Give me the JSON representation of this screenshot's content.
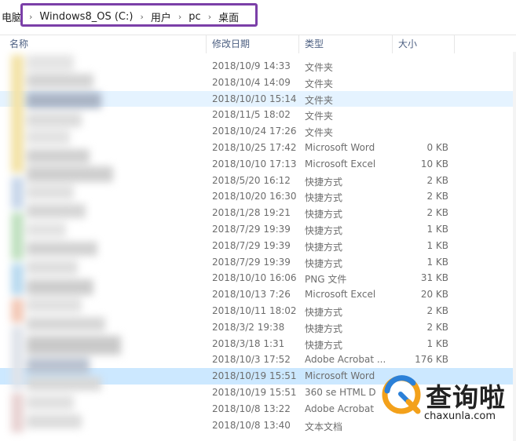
{
  "address": {
    "crumbs": [
      {
        "label": "电脑"
      },
      {
        "label": "Windows8_OS (C:)"
      },
      {
        "label": "用户"
      },
      {
        "label": "pc"
      },
      {
        "label": "桌面"
      }
    ]
  },
  "columns": {
    "name": "名称",
    "date": "修改日期",
    "type": "类型",
    "size": "大小"
  },
  "rows": [
    {
      "date": "2018/10/9 14:33",
      "type": "文件夹",
      "size": ""
    },
    {
      "date": "2018/10/4 14:09",
      "type": "文件夹",
      "size": ""
    },
    {
      "date": "2018/10/10 15:14",
      "type": "文件夹",
      "size": ""
    },
    {
      "date": "2018/11/5 18:02",
      "type": "文件夹",
      "size": ""
    },
    {
      "date": "2018/10/24 17:26",
      "type": "文件夹",
      "size": ""
    },
    {
      "date": "2018/10/25 17:42",
      "type": "Microsoft Word",
      "size": "0 KB"
    },
    {
      "date": "2018/10/10 17:13",
      "type": "Microsoft Excel",
      "size": "10 KB"
    },
    {
      "date": "2018/5/20 16:12",
      "type": "快捷方式",
      "size": "2 KB"
    },
    {
      "date": "2018/10/20 16:30",
      "type": "快捷方式",
      "size": "2 KB"
    },
    {
      "date": "2018/1/28 19:21",
      "type": "快捷方式",
      "size": "2 KB"
    },
    {
      "date": "2018/7/29 19:39",
      "type": "快捷方式",
      "size": "1 KB"
    },
    {
      "date": "2018/7/29 19:39",
      "type": "快捷方式",
      "size": "1 KB"
    },
    {
      "date": "2018/7/29 19:39",
      "type": "快捷方式",
      "size": "1 KB"
    },
    {
      "date": "2018/10/10 16:06",
      "type": "PNG 文件",
      "size": "31 KB"
    },
    {
      "date": "2018/10/13 7:26",
      "type": "Microsoft Excel",
      "size": "20 KB"
    },
    {
      "date": "2018/10/11 18:02",
      "type": "快捷方式",
      "size": "2 KB"
    },
    {
      "date": "2018/3/2 19:38",
      "type": "快捷方式",
      "size": "2 KB"
    },
    {
      "date": "2018/3/18 1:31",
      "type": "快捷方式",
      "size": "1 KB"
    },
    {
      "date": "2018/10/3 17:52",
      "type": "Adobe Acrobat ...",
      "size": "176 KB"
    },
    {
      "date": "2018/10/19 15:51",
      "type": "Microsoft Word",
      "size": ""
    },
    {
      "date": "2018/10/19 15:51",
      "type": "360 se HTML D",
      "size": ""
    },
    {
      "date": "2018/10/8 13:22",
      "type": "Adobe Acrobat",
      "size": ""
    },
    {
      "date": "2018/10/8 13:40",
      "type": "文本文档",
      "size": ""
    }
  ],
  "watermark": {
    "text": "查询啦",
    "url": "chaxunla.com"
  },
  "colors": {
    "accent": "#7b3fa8",
    "hover_row": "#e5f3ff",
    "selected_row": "#cce8ff"
  }
}
